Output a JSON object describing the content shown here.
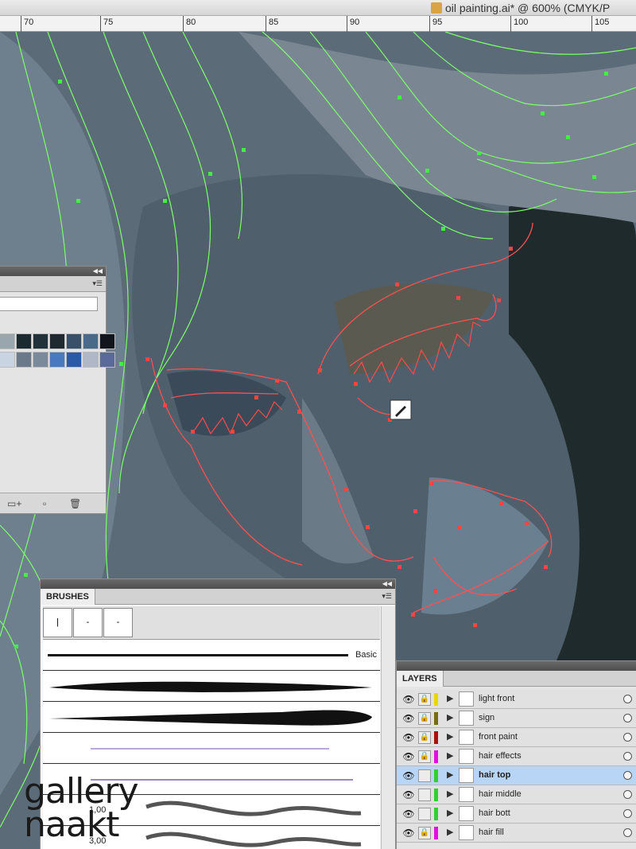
{
  "document": {
    "title": "oil painting.ai* @ 600% (CMYK/P"
  },
  "ruler": {
    "labels": [
      "70",
      "75",
      "80",
      "85",
      "90",
      "95",
      "100",
      "105"
    ]
  },
  "swatches": {
    "row1": [
      "#9aa6ad",
      "#1a2a2e",
      "#22323a",
      "#1e2a30",
      "#3a5068",
      "#4a6a8a",
      "#12161c"
    ],
    "row2": [
      "#c8d4e2",
      "#6a7a8a",
      "#7a8a9a",
      "#4a78c0",
      "#2a5aa8",
      "#b0b8c8",
      "#5a6a9a"
    ]
  },
  "brushes": {
    "tab": "BRUSHES",
    "thumbs": [
      "|",
      "-",
      "-"
    ],
    "basic_label": "Basic",
    "size_labels": [
      "1,00",
      "3,00"
    ]
  },
  "layers": {
    "tab": "LAYERS",
    "items": [
      {
        "name": "light front",
        "color": "#e6d800",
        "locked": true,
        "selected": false
      },
      {
        "name": "sign",
        "color": "#7a6a10",
        "locked": true,
        "selected": false
      },
      {
        "name": "front paint",
        "color": "#aa1010",
        "locked": true,
        "selected": false
      },
      {
        "name": "hair effects",
        "color": "#e010e0",
        "locked": true,
        "selected": false
      },
      {
        "name": "hair top",
        "color": "#30d030",
        "locked": false,
        "selected": true
      },
      {
        "name": "hair middle",
        "color": "#30d030",
        "locked": false,
        "selected": false
      },
      {
        "name": "hair bott",
        "color": "#30d030",
        "locked": false,
        "selected": false
      },
      {
        "name": "hair fill",
        "color": "#e010e0",
        "locked": true,
        "selected": false
      }
    ]
  },
  "watermark": {
    "line1": "gallery",
    "line2": "naakt"
  }
}
